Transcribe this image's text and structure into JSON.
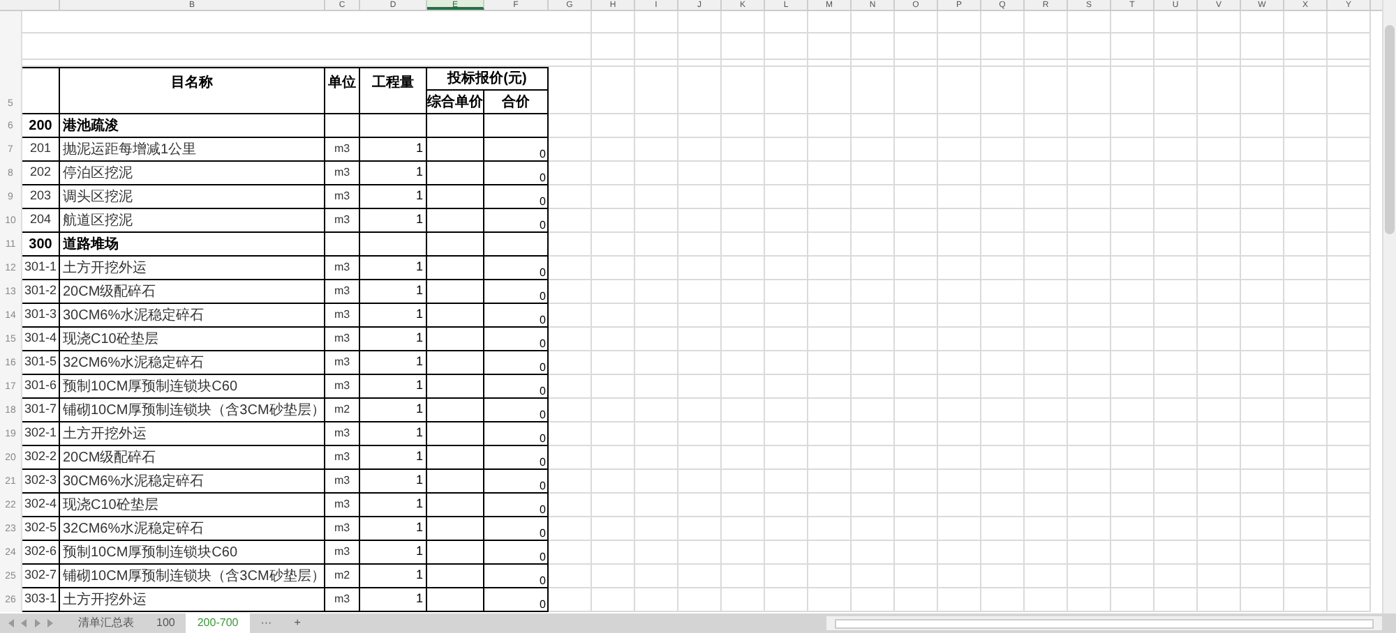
{
  "column_headers": [
    {
      "label": "B",
      "selected": false
    },
    {
      "label": "C",
      "selected": false
    },
    {
      "label": "D",
      "selected": false
    },
    {
      "label": "E",
      "selected": true
    },
    {
      "label": "F",
      "selected": false
    },
    {
      "label": "G",
      "selected": false
    },
    {
      "label": "H",
      "selected": false
    },
    {
      "label": "I",
      "selected": false
    },
    {
      "label": "J",
      "selected": false
    },
    {
      "label": "K",
      "selected": false
    },
    {
      "label": "L",
      "selected": false
    },
    {
      "label": "M",
      "selected": false
    },
    {
      "label": "N",
      "selected": false
    },
    {
      "label": "O",
      "selected": false
    },
    {
      "label": "P",
      "selected": false
    },
    {
      "label": "Q",
      "selected": false
    },
    {
      "label": "R",
      "selected": false
    },
    {
      "label": "S",
      "selected": false
    },
    {
      "label": "T",
      "selected": false
    },
    {
      "label": "U",
      "selected": false
    },
    {
      "label": "V",
      "selected": false
    },
    {
      "label": "W",
      "selected": false
    },
    {
      "label": "X",
      "selected": false
    },
    {
      "label": "Y",
      "selected": false
    }
  ],
  "table_header": {
    "row_number": "5",
    "name": "目名称",
    "unit": "单位",
    "quantity": "工程量",
    "price_group": "投标报价(元)",
    "unit_price": "综合单价",
    "total": "合价"
  },
  "rows": [
    {
      "row_number": "6",
      "kind": "section",
      "code": "200",
      "name": "港池疏浚"
    },
    {
      "row_number": "7",
      "kind": "item",
      "code": "201",
      "name": "抛泥运距每增减1公里",
      "unit": "m3",
      "quantity": "1",
      "total": "0"
    },
    {
      "row_number": "8",
      "kind": "item",
      "code": "202",
      "name": "停泊区挖泥",
      "unit": "m3",
      "quantity": "1",
      "total": "0"
    },
    {
      "row_number": "9",
      "kind": "item",
      "code": "203",
      "name": "调头区挖泥",
      "unit": "m3",
      "quantity": "1",
      "total": "0"
    },
    {
      "row_number": "10",
      "kind": "item",
      "code": "204",
      "name": "航道区挖泥",
      "unit": "m3",
      "quantity": "1",
      "total": "0"
    },
    {
      "row_number": "11",
      "kind": "section",
      "code": "300",
      "name": "道路堆场"
    },
    {
      "row_number": "12",
      "kind": "item",
      "code": "301-1",
      "name": "土方开挖外运",
      "unit": "m3",
      "quantity": "1",
      "total": "0"
    },
    {
      "row_number": "13",
      "kind": "item",
      "code": "301-2",
      "name": "20CM级配碎石",
      "unit": "m3",
      "quantity": "1",
      "total": "0"
    },
    {
      "row_number": "14",
      "kind": "item",
      "code": "301-3",
      "name": "30CM6%水泥稳定碎石",
      "unit": "m3",
      "quantity": "1",
      "total": "0"
    },
    {
      "row_number": "15",
      "kind": "item",
      "code": "301-4",
      "name": "现浇C10砼垫层",
      "unit": "m3",
      "quantity": "1",
      "total": "0"
    },
    {
      "row_number": "16",
      "kind": "item",
      "code": "301-5",
      "name": "32CM6%水泥稳定碎石",
      "unit": "m3",
      "quantity": "1",
      "total": "0"
    },
    {
      "row_number": "17",
      "kind": "item",
      "code": "301-6",
      "name": "预制10CM厚预制连锁块C60",
      "unit": "m3",
      "quantity": "1",
      "total": "0"
    },
    {
      "row_number": "18",
      "kind": "item",
      "code": "301-7",
      "name": "铺砌10CM厚预制连锁块（含3CM砂垫层）",
      "unit": "m2",
      "quantity": "1",
      "total": "0"
    },
    {
      "row_number": "19",
      "kind": "item",
      "code": "302-1",
      "name": "土方开挖外运",
      "unit": "m3",
      "quantity": "1",
      "total": "0"
    },
    {
      "row_number": "20",
      "kind": "item",
      "code": "302-2",
      "name": "20CM级配碎石",
      "unit": "m3",
      "quantity": "1",
      "total": "0"
    },
    {
      "row_number": "21",
      "kind": "item",
      "code": "302-3",
      "name": "30CM6%水泥稳定碎石",
      "unit": "m3",
      "quantity": "1",
      "total": "0"
    },
    {
      "row_number": "22",
      "kind": "item",
      "code": "302-4",
      "name": "现浇C10砼垫层",
      "unit": "m3",
      "quantity": "1",
      "total": "0"
    },
    {
      "row_number": "23",
      "kind": "item",
      "code": "302-5",
      "name": "32CM6%水泥稳定碎石",
      "unit": "m3",
      "quantity": "1",
      "total": "0"
    },
    {
      "row_number": "24",
      "kind": "item",
      "code": "302-6",
      "name": "预制10CM厚预制连锁块C60",
      "unit": "m3",
      "quantity": "1",
      "total": "0"
    },
    {
      "row_number": "25",
      "kind": "item",
      "code": "302-7",
      "name": "铺砌10CM厚预制连锁块（含3CM砂垫层）",
      "unit": "m2",
      "quantity": "1",
      "total": "0"
    },
    {
      "row_number": "26",
      "kind": "item",
      "code": "303-1",
      "name": "土方开挖外运",
      "unit": "m3",
      "quantity": "1",
      "total": "0"
    }
  ],
  "sheet_tabs": [
    {
      "label": "清单汇总表",
      "selected": false
    },
    {
      "label": "100",
      "selected": false
    },
    {
      "label": "200-700",
      "selected": true
    },
    {
      "label": "···",
      "selected": false
    },
    {
      "label": "+",
      "selected": false
    }
  ]
}
